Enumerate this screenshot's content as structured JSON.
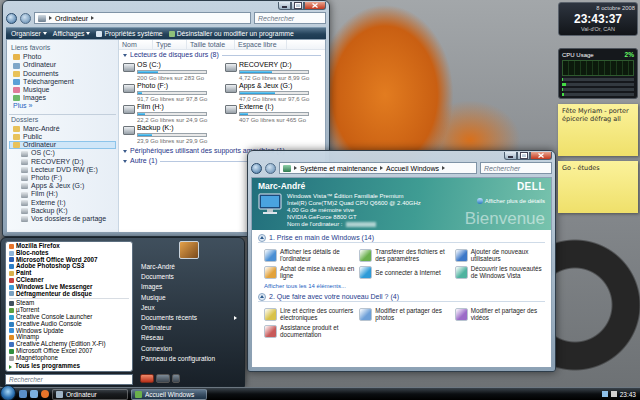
{
  "explorer": {
    "address": [
      "Ordinateur"
    ],
    "search": {
      "placeholder": "Rechercher"
    },
    "toolbar": [
      {
        "label": "Organiser",
        "menu": true
      },
      {
        "label": "Affichages",
        "menu": true
      },
      {
        "label": "Propriétés système",
        "menu": false
      },
      {
        "label": "Désinstaller ou modifier un programme",
        "menu": false
      }
    ],
    "favorites": {
      "title": "Liens favoris",
      "items": [
        "Photo",
        "Ordinateur",
        "Documents",
        "Téléchargement",
        "Musique",
        "Images"
      ],
      "more": "Plus »"
    },
    "folders": {
      "title": "Dossiers",
      "items": [
        {
          "label": "Marc-André",
          "depth": 0,
          "selected": false
        },
        {
          "label": "Public",
          "depth": 0,
          "selected": false
        },
        {
          "label": "Ordinateur",
          "depth": 0,
          "selected": true
        },
        {
          "label": "OS (C:)",
          "depth": 1,
          "selected": false
        },
        {
          "label": "RECOVERY (D:)",
          "depth": 1,
          "selected": false
        },
        {
          "label": "Lecteur DVD RW (E:)",
          "depth": 1,
          "selected": false
        },
        {
          "label": "Photo (F:)",
          "depth": 1,
          "selected": false
        },
        {
          "label": "Apps & Jeux (G:)",
          "depth": 1,
          "selected": false
        },
        {
          "label": "Film (H:)",
          "depth": 1,
          "selected": false
        },
        {
          "label": "Externe (I:)",
          "depth": 1,
          "selected": false
        },
        {
          "label": "Backup (K:)",
          "depth": 1,
          "selected": false
        },
        {
          "label": "Vos dossiers de partage",
          "depth": 1,
          "selected": false
        }
      ]
    },
    "columns": [
      "Nom",
      "Type",
      "Taille totale",
      "Espace libre"
    ],
    "drives_group": "Lecteurs de disques durs (8)",
    "drives": [
      {
        "name": "OS (C:)",
        "level": 0.29,
        "free": "200 Go libres sur 283 Go"
      },
      {
        "name": "RECOVERY (D:)",
        "level": 0.47,
        "free": "4,72 Go libres sur 8,99 Go"
      },
      {
        "name": "Photo (F:)",
        "level": 0.06,
        "free": "91,7 Go libres sur 97,8 Go"
      },
      {
        "name": "Apps & Jeux (G:)",
        "level": 0.52,
        "free": "47,0 Go libres sur 97,6 Go"
      },
      {
        "name": "Film (H:)",
        "level": 0.11,
        "free": "22,2 Go libres sur 24,9 Go"
      },
      {
        "name": "Externe (I:)",
        "level": 0.12,
        "free": "407 Go libres sur 465 Go"
      },
      {
        "name": "Backup (K:)",
        "level": 0.2,
        "free": "23,9 Go libres sur 29,9 Go"
      }
    ],
    "other_groups": [
      "Périphériques utilisant des supports amovibles (1)",
      "Autre (1)"
    ]
  },
  "welcome": {
    "address": [
      "Système et maintenance",
      "Accueil Windows"
    ],
    "search": {
      "placeholder": "Rechercher"
    },
    "user": "Marc-André",
    "specs": [
      "Windows Vista™ Édition Familiale Premium",
      "Intel(R) Core(TM)2 Quad CPU Q6600 @ 2.40GHz",
      "4,00 Go de mémoire vive",
      "NVIDIA GeForce 8800 GT",
      "Nom de l'ordinateur :"
    ],
    "details_link": "Afficher plus de détails",
    "logo": "DELL",
    "watermark": "Bienvenue",
    "sections": [
      {
        "title": "1. Prise en main de Windows (14)",
        "expanded": true,
        "items": [
          "Afficher les détails de l'ordinateur",
          "Transférer des fichiers et des paramètres",
          "Ajouter de nouveaux utilisateurs",
          "Achat de mise à niveau en ligne",
          "Se connecter à Internet",
          "Découvrir les nouveautés de Windows Vista"
        ],
        "more": "Afficher tous les 14 éléments..."
      },
      {
        "title": "2. Que faire avec votre nouveau Dell ? (4)",
        "expanded": true,
        "items": [
          "Lire et écrire des courriers électroniques",
          "Modifier et partager des photos",
          "Modifier et partager des vidéos",
          "Assistance produit et documentation"
        ]
      }
    ]
  },
  "start_menu": {
    "programs": [
      {
        "label": "Mozilla Firefox",
        "pinned": true
      },
      {
        "label": "Bloc-notes",
        "pinned": true
      },
      {
        "label": "Microsoft Office Word 2007",
        "pinned": true
      },
      {
        "label": "Adobe Photoshop CS3",
        "pinned": true
      },
      {
        "label": "Paint",
        "pinned": true
      },
      {
        "label": "CCleaner",
        "pinned": true
      },
      {
        "label": "Windows Live Messenger",
        "pinned": true
      },
      {
        "label": "Défragmenteur de disque",
        "pinned": true
      },
      {
        "label": "Steam",
        "pinned": false
      },
      {
        "label": "µTorrent",
        "pinned": false
      },
      {
        "label": "Creative Console Launcher",
        "pinned": false
      },
      {
        "label": "Creative Audio Console",
        "pinned": false
      },
      {
        "label": "Windows Update",
        "pinned": false
      },
      {
        "label": "Winamp",
        "pinned": false
      },
      {
        "label": "Creative ALchemy (Edition X-Fi)",
        "pinned": false
      },
      {
        "label": "Microsoft Office Excel 2007",
        "pinned": false
      },
      {
        "label": "Magnétophone",
        "pinned": false
      }
    ],
    "all_programs": "Tous les programmes",
    "search": {
      "placeholder": "Rechercher"
    },
    "places": [
      {
        "label": "Marc-André",
        "submenu": false
      },
      {
        "label": "Documents",
        "submenu": false
      },
      {
        "label": "Images",
        "submenu": false
      },
      {
        "label": "Musique",
        "submenu": false
      },
      {
        "label": "Jeux",
        "submenu": false
      },
      {
        "label": "Documents récents",
        "submenu": true
      },
      {
        "label": "Ordinateur",
        "submenu": false
      },
      {
        "label": "Réseau",
        "submenu": false
      },
      {
        "label": "Connexion",
        "submenu": false
      },
      {
        "label": "Panneau de configuration",
        "submenu": false
      }
    ]
  },
  "taskbar": {
    "tasks": [
      {
        "label": "Ordinateur",
        "selected": false
      },
      {
        "label": "Accueil Windows",
        "selected": true
      }
    ],
    "clock": "23:43"
  },
  "sidebar": {
    "clock": {
      "date": "8 octobre 2008",
      "time": "23:43:37",
      "place": "Val-d'Or, CAN"
    },
    "cpu": {
      "title": "CPU Usage",
      "reading": "2%",
      "cores": [
        {
          "level": 0.02
        },
        {
          "level": 0.05
        },
        {
          "level": 0.01
        },
        {
          "level": 0.03
        }
      ]
    },
    "notes": [
      "Fête Myriam - porter épicerie défrag all",
      "Go - études"
    ]
  }
}
